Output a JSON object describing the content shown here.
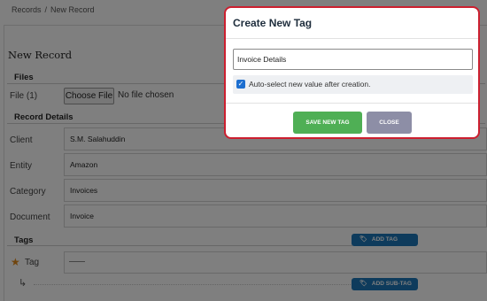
{
  "breadcrumb": {
    "root": "Records",
    "separator": "/",
    "current": "New Record"
  },
  "page": {
    "title": "New Record"
  },
  "files": {
    "section_title": "Files",
    "row_label": "File (1)",
    "choose_file_label": "Choose File",
    "file_status": "No file chosen"
  },
  "record_details": {
    "section_title": "Record Details",
    "fields": [
      {
        "label": "Client",
        "value": "S.M. Salahuddin"
      },
      {
        "label": "Entity",
        "value": "Amazon"
      },
      {
        "label": "Category",
        "value": "Invoices"
      },
      {
        "label": "Document",
        "value": "Invoice"
      }
    ]
  },
  "tags": {
    "section_title": "Tags",
    "add_tag_label": "ADD TAG",
    "tag_row_label": "Tag",
    "add_sub_tag_label": "ADD SUB-TAG"
  },
  "modal": {
    "title": "Create New Tag",
    "input_value": "Invoice Details",
    "checkbox_checked": true,
    "checkbox_label": "Auto-select new value after creation.",
    "save_label": "SAVE NEW TAG",
    "close_label": "CLOSE"
  },
  "colors": {
    "modal_border": "#cc1f2f",
    "save_button": "#4faf55",
    "close_button": "#8d8ea6",
    "tag_button": "#1d77b8",
    "star": "#e08a1c"
  },
  "icons": {
    "star": "star-icon",
    "sub_tag_arrow": "corner-down-right-icon",
    "tag": "tag-icon",
    "checkbox": "check-icon"
  }
}
